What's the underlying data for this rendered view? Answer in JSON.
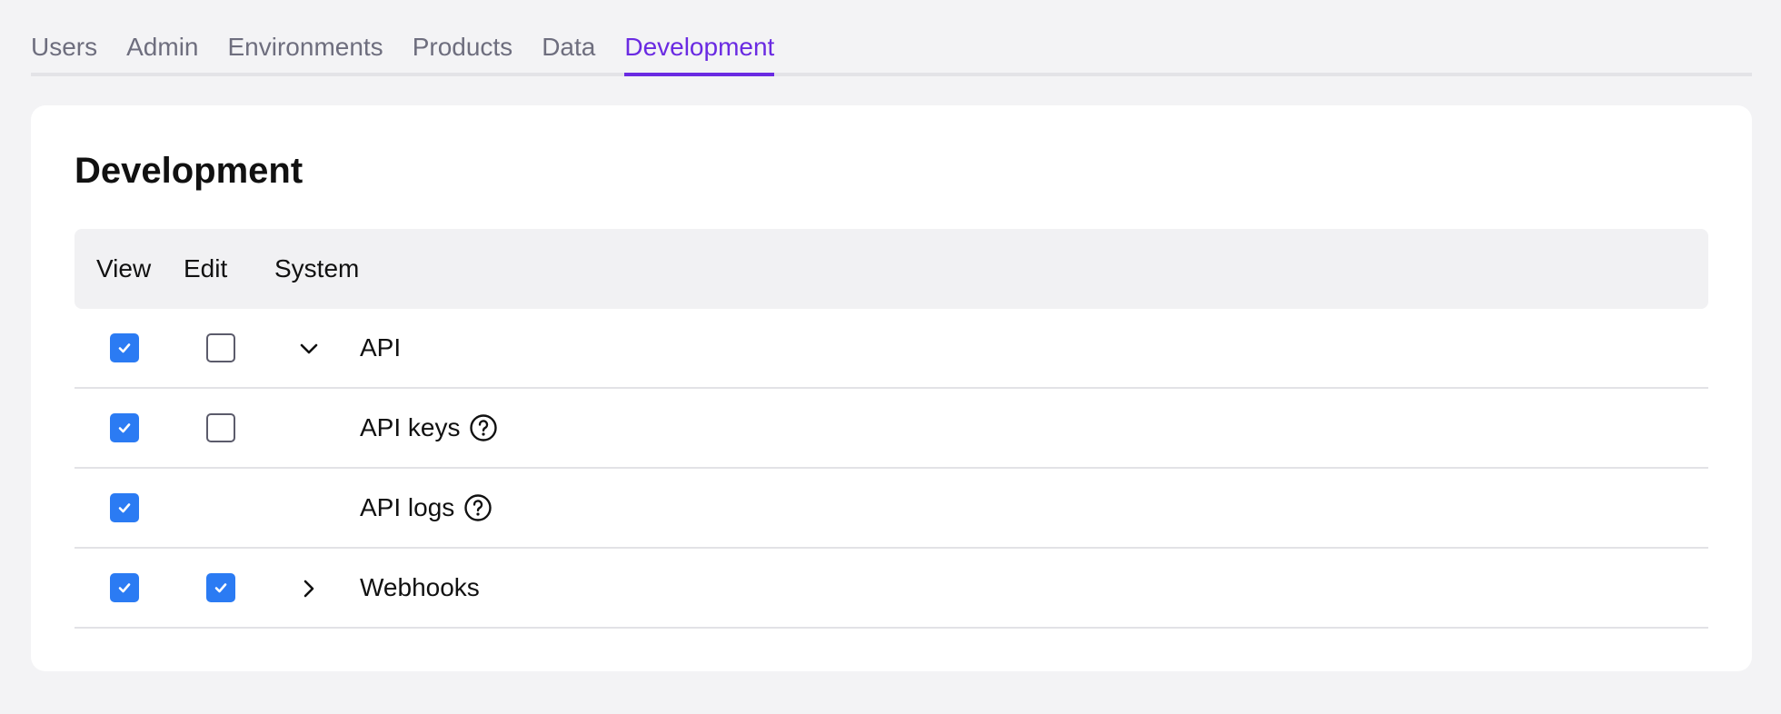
{
  "tabs": [
    {
      "label": "Users",
      "active": false
    },
    {
      "label": "Admin",
      "active": false
    },
    {
      "label": "Environments",
      "active": false
    },
    {
      "label": "Products",
      "active": false
    },
    {
      "label": "Data",
      "active": false
    },
    {
      "label": "Development",
      "active": true
    }
  ],
  "card": {
    "title": "Development"
  },
  "table": {
    "headers": {
      "view": "View",
      "edit": "Edit",
      "system": "System"
    },
    "rows": [
      {
        "label": "API",
        "view": true,
        "edit": false,
        "chevron": "chevron-down-icon",
        "help": false
      },
      {
        "label": "API keys",
        "view": true,
        "edit": false,
        "chevron": null,
        "help": true
      },
      {
        "label": "API logs",
        "view": true,
        "edit": null,
        "chevron": null,
        "help": true
      },
      {
        "label": "Webhooks",
        "view": true,
        "edit": true,
        "chevron": "chevron-right-icon",
        "help": false
      }
    ]
  },
  "colors": {
    "accent": "#6a2ae2",
    "checkbox": "#2b7bf3"
  }
}
